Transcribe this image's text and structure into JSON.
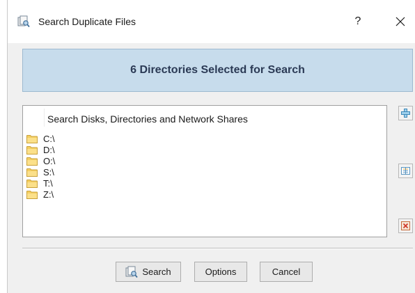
{
  "window": {
    "title": "Search Duplicate Files",
    "help_label": "?",
    "close_icon": "close-icon",
    "app_icon": "duplicate-search-app-icon"
  },
  "banner": {
    "text": "6 Directories Selected for Search",
    "background_color": "#c7dcec"
  },
  "list": {
    "header": "Search Disks, Directories and Network Shares",
    "items": [
      {
        "label": "C:\\",
        "icon": "folder-icon"
      },
      {
        "label": "D:\\",
        "icon": "folder-icon"
      },
      {
        "label": "O:\\",
        "icon": "folder-icon"
      },
      {
        "label": "S:\\",
        "icon": "folder-icon"
      },
      {
        "label": "T:\\",
        "icon": "folder-icon"
      },
      {
        "label": "Z:\\",
        "icon": "folder-icon"
      }
    ]
  },
  "side_buttons": [
    {
      "name": "add-directory-button",
      "icon": "plus-icon"
    },
    {
      "name": "edit-directory-button",
      "icon": "list-icon"
    },
    {
      "name": "remove-directory-button",
      "icon": "remove-icon"
    }
  ],
  "buttons": {
    "search": "Search",
    "options": "Options",
    "cancel": "Cancel"
  }
}
